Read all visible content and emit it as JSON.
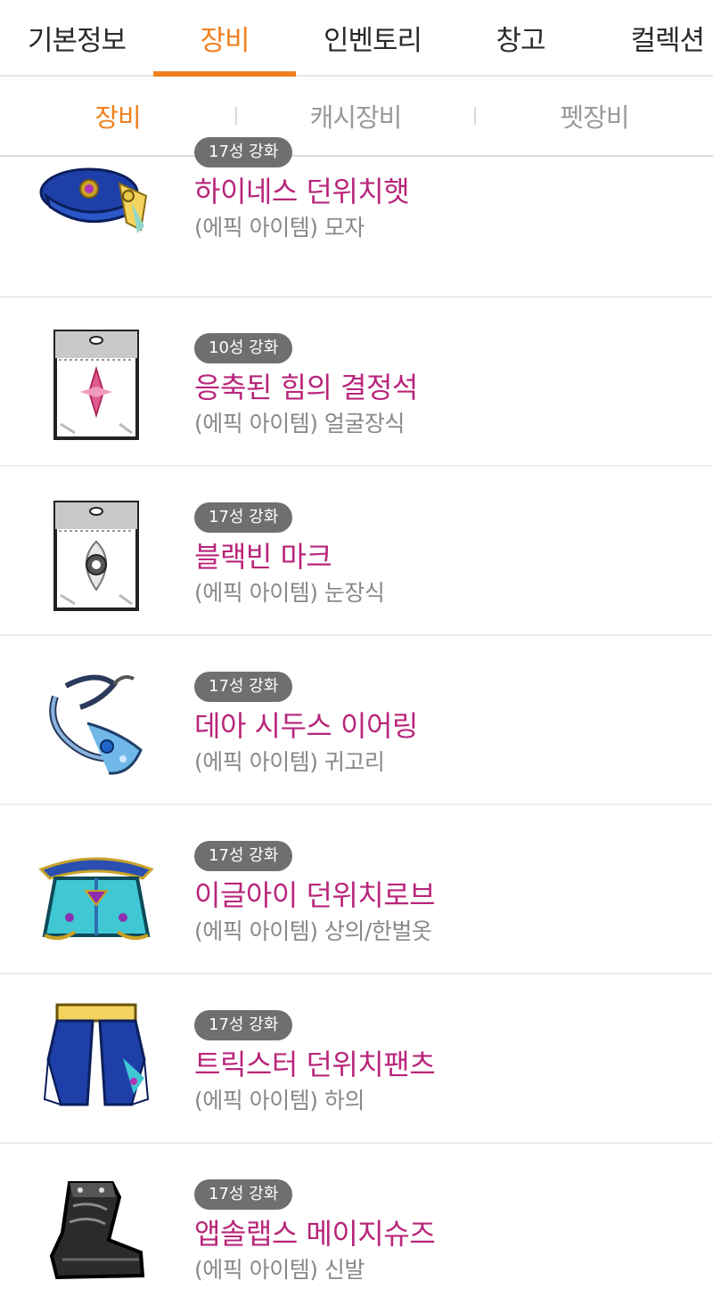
{
  "main_tabs": [
    {
      "label": "기본정보",
      "active": false
    },
    {
      "label": "장비",
      "active": true
    },
    {
      "label": "인벤토리",
      "active": false
    },
    {
      "label": "창고",
      "active": false
    },
    {
      "label": "컬렉션",
      "active": false
    }
  ],
  "sub_tabs": [
    {
      "label": "장비",
      "active": true
    },
    {
      "label": "캐시장비",
      "active": false
    },
    {
      "label": "펫장비",
      "active": false
    }
  ],
  "colors": {
    "accent": "#f0801e",
    "item_name": "#b8267a",
    "badge_bg": "#6f6f6f",
    "sub_text": "#888888"
  },
  "items": [
    {
      "badge": "17성 강화",
      "name": "하이네스 던위치햇",
      "type": "(에픽 아이템) 모자",
      "icon": "hat-icon"
    },
    {
      "badge": "10성 강화",
      "name": "응축된 힘의 결정석",
      "type": "(에픽 아이템) 얼굴장식",
      "icon": "face-accessory-icon"
    },
    {
      "badge": "17성 강화",
      "name": "블랙빈 마크",
      "type": "(에픽 아이템) 눈장식",
      "icon": "eye-accessory-icon"
    },
    {
      "badge": "17성 강화",
      "name": "데아 시두스 이어링",
      "type": "(에픽 아이템) 귀고리",
      "icon": "earring-icon"
    },
    {
      "badge": "17성 강화",
      "name": "이글아이 던위치로브",
      "type": "(에픽 아이템) 상의/한벌옷",
      "icon": "robe-icon"
    },
    {
      "badge": "17성 강화",
      "name": "트릭스터 던위치팬츠",
      "type": "(에픽 아이템) 하의",
      "icon": "pants-icon"
    },
    {
      "badge": "17성 강화",
      "name": "앱솔랩스 메이지슈즈",
      "type": "(에픽 아이템) 신발",
      "icon": "shoes-icon"
    }
  ]
}
